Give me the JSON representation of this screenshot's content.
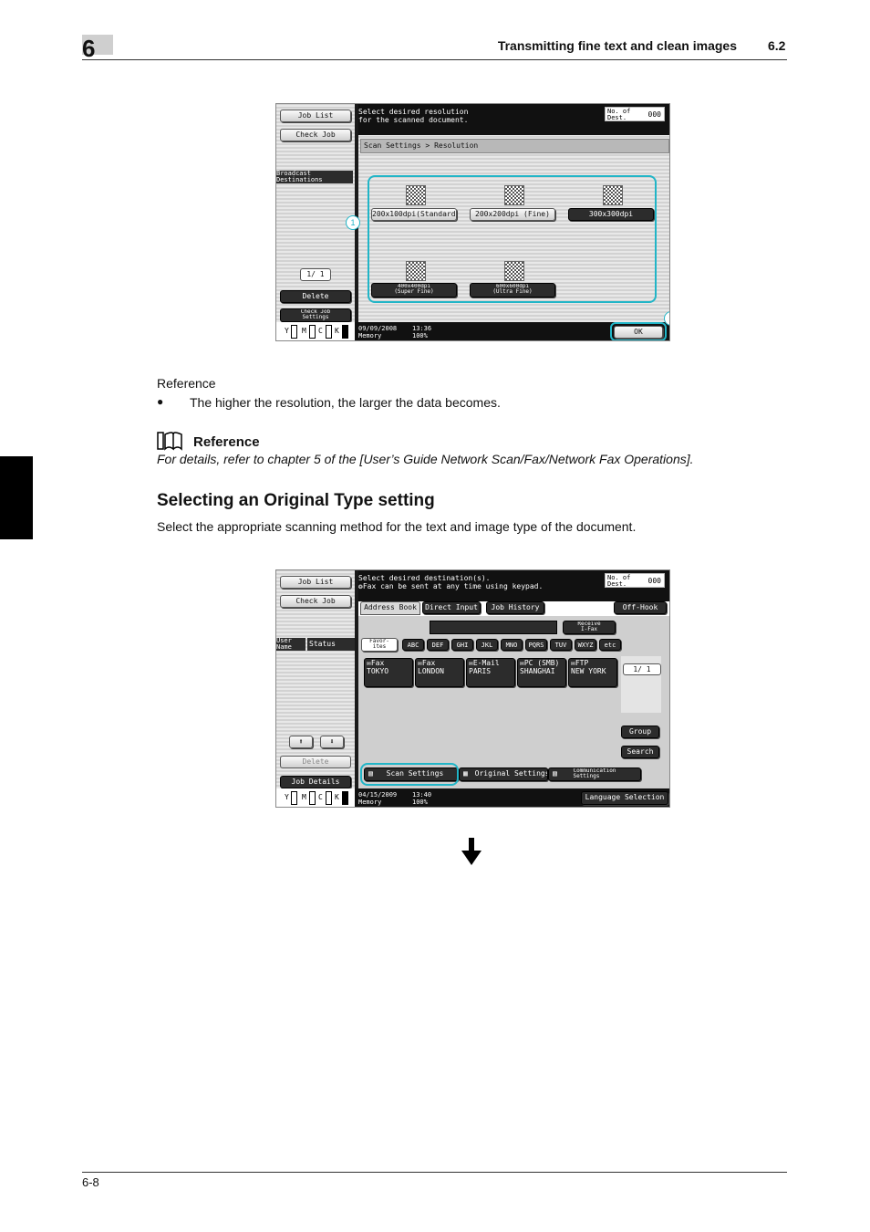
{
  "header": {
    "chapter_number": "6",
    "section_title": "Transmitting fine text and clean images",
    "section_number": "6.2"
  },
  "reference": {
    "label": "Reference",
    "bullet": "The higher the resolution, the larger the data becomes.",
    "box_title": "Reference",
    "box_text": "For details, refer to chapter 5 of the [User’s Guide Network Scan/Fax/Network Fax Operations]."
  },
  "section": {
    "heading": "Selecting an Original Type setting",
    "body": "Select the appropriate scanning method for the text and image type of the document."
  },
  "screen1": {
    "side": {
      "job_list": "Job List",
      "check_job": "Check Job",
      "broadcast": "Broadcast\nDestinations",
      "page": "1/   1",
      "delete": "Delete",
      "check_job_settings": "Check Job\nSettings"
    },
    "message": "Select desired resolution\nfor the scanned document.",
    "dest_label": "No. of\nDest.",
    "dest_value": "000",
    "breadcrumb": "Scan Settings > Resolution",
    "options": [
      "200x100dpi(Standard)",
      "200x200dpi (Fine)",
      "300x300dpi",
      "400x400dpi\n(Super Fine)",
      "600x600dpi\n(Ultra Fine)"
    ],
    "ok": "OK",
    "callouts": [
      "1",
      "2"
    ],
    "datetime": "09/09/2008    13:36\nMemory        100%",
    "ymck": [
      "Y",
      "M",
      "C",
      "K"
    ]
  },
  "screen2": {
    "side": {
      "job_list": "Job List",
      "check_job": "Check Job",
      "user_name": "User\nName",
      "status": "Status",
      "delete": "Delete",
      "job_details": "Job Details"
    },
    "message": "Select desired destination(s).\n❂Fax can be sent at any time using keypad.",
    "dest_label": "No. of\nDest.",
    "dest_value": "000",
    "tabs": [
      "Address Book",
      "Direct Input",
      "Job History"
    ],
    "off_hook": "Off-Hook",
    "receive": "Receive\nI-Fax",
    "index_tabs": [
      "Favor-\nites",
      "ABC",
      "DEF",
      "GHI",
      "JKL",
      "MNO",
      "PQRS",
      "TUV",
      "WXYZ",
      "etc"
    ],
    "destinations": [
      "✉Fax\nTOKYO",
      "✉Fax\nLONDON",
      "✉E-Mail\nPARIS",
      "✉PC (SMB)\nSHANGHAI",
      "✉FTP\nNEW YORK"
    ],
    "page": "1/   1",
    "group": "Group",
    "search": "Search",
    "scan_settings": "Scan Settings",
    "original_settings": "Original Settings",
    "communication_settings": "Communication\nSettings",
    "language": "Language Selection",
    "datetime": "04/15/2009    13:40\nMemory        100%",
    "ymck": [
      "Y",
      "M",
      "C",
      "K"
    ]
  },
  "footer": {
    "page_number": "6-8"
  }
}
